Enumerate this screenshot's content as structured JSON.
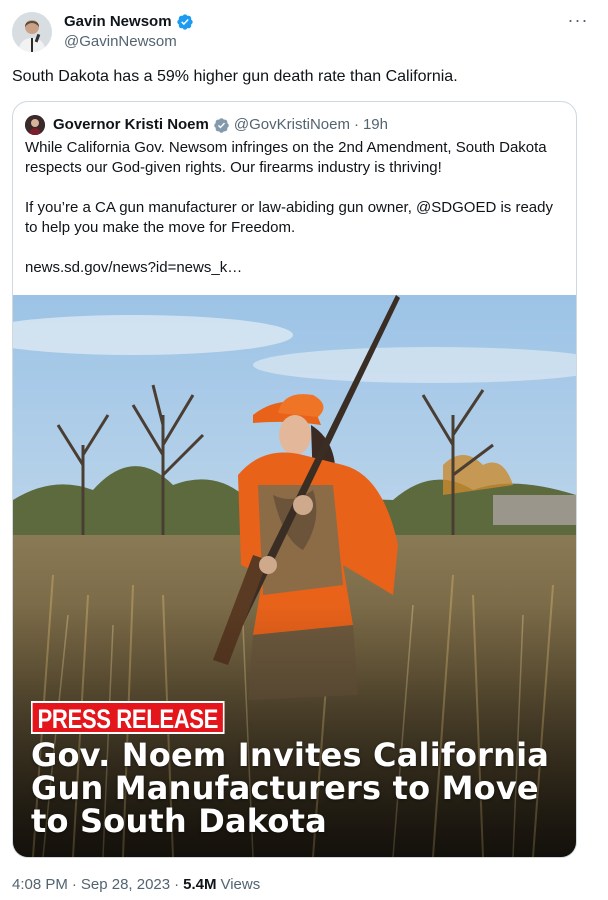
{
  "tweet": {
    "author_name": "Gavin Newsom",
    "author_handle": "@GavinNewsom",
    "verified_icon": "verified-badge-icon",
    "more_icon": "more-options-icon",
    "more_label": "···",
    "text": "South Dakota has a 59% higher gun death rate than California."
  },
  "quote": {
    "author_name": "Governor Kristi Noem",
    "author_handle": "@GovKristiNoem",
    "separator": "·",
    "time_ago": "19h",
    "verified_icon": "verified-badge-gray-icon",
    "paragraph_1": "While California Gov. Newsom infringes on the 2nd Amendment, South Dakota respects our God-given rights. Our firearms industry is thriving!",
    "paragraph_2": "If you’re a CA gun manufacturer or law-abiding gun owner, @SDGOED is ready to help you make the move for Freedom.",
    "link": "news.sd.gov/news?id=news_k…",
    "media": {
      "badge": "PRESS RELEASE",
      "headline": "Gov. Noem Invites California Gun Manufacturers to Move to South Dakota"
    }
  },
  "meta": {
    "time": "4:08 PM",
    "date": "Sep 28, 2023",
    "separator_1": "·",
    "separator_2": "·",
    "views_count": "5.4M",
    "views_label": "Views"
  }
}
